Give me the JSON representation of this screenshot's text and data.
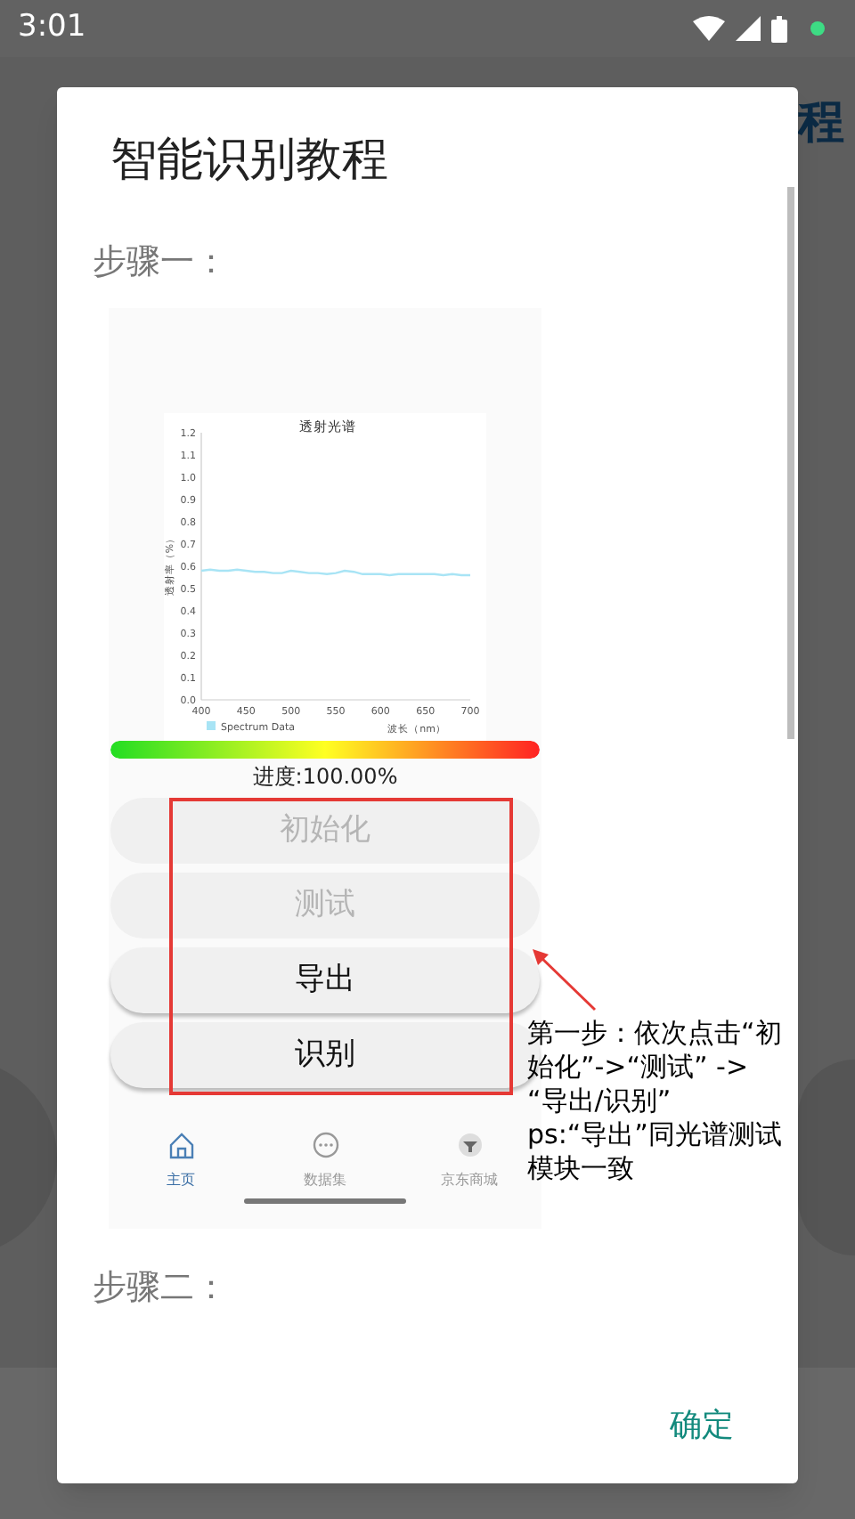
{
  "status_bar": {
    "time": "3:01"
  },
  "background": {
    "title_fragment": "程"
  },
  "dialog": {
    "title": "智能识别教程",
    "step_1": "步骤一：",
    "screenshot": {
      "chart_data": {
        "type": "line",
        "title": "透射光谱",
        "xlabel": "波长（nm）",
        "ylabel": "透射率（%）",
        "x": [
          400,
          410,
          420,
          430,
          440,
          450,
          460,
          470,
          480,
          490,
          500,
          510,
          520,
          530,
          540,
          550,
          560,
          570,
          580,
          590,
          600,
          610,
          620,
          630,
          640,
          650,
          660,
          670,
          680,
          690,
          700
        ],
        "series": [
          {
            "name": "Spectrum Data",
            "color": "#a8e4f5",
            "values": [
              0.58,
              0.585,
              0.58,
              0.58,
              0.585,
              0.58,
              0.575,
              0.575,
              0.57,
              0.57,
              0.58,
              0.575,
              0.57,
              0.57,
              0.565,
              0.57,
              0.58,
              0.575,
              0.565,
              0.565,
              0.565,
              0.56,
              0.565,
              0.565,
              0.565,
              0.565,
              0.565,
              0.56,
              0.565,
              0.56,
              0.56
            ]
          }
        ],
        "xlim": [
          400,
          700
        ],
        "ylim": [
          0,
          1.2
        ],
        "xticks": [
          400,
          450,
          500,
          550,
          600,
          650,
          700
        ],
        "yticks": [
          {
            "value": 0,
            "label": "0.0"
          },
          {
            "value": 0.1,
            "label": "0.1"
          },
          {
            "value": 0.2,
            "label": "0.2"
          },
          {
            "value": 0.3,
            "label": "0.3"
          },
          {
            "value": 0.4,
            "label": "0.4"
          },
          {
            "value": 0.5,
            "label": "0.5"
          },
          {
            "value": 0.6,
            "label": "0.6"
          },
          {
            "value": 0.7,
            "label": "0.7"
          },
          {
            "value": 0.8,
            "label": "0.8"
          },
          {
            "value": 0.9,
            "label": "0.9"
          },
          {
            "value": 1,
            "label": "1.0"
          },
          {
            "value": 1.1,
            "label": "1.1"
          },
          {
            "value": 1.2,
            "label": "1.2"
          }
        ]
      },
      "progress": {
        "level": 1,
        "label": "进度:100.00%"
      },
      "buttons": [
        {
          "label": "初始化",
          "disabled": true
        },
        {
          "label": "测试",
          "disabled": true
        },
        {
          "label": "导出",
          "disabled": false
        },
        {
          "label": "识别",
          "disabled": false
        }
      ],
      "nav": [
        {
          "label": "主页",
          "selected": true
        },
        {
          "label": "数据集",
          "selected": false
        },
        {
          "label": "京东商城",
          "selected": false
        }
      ]
    },
    "annotation": "第一步：依次点击“初始化”->“测试” -> “导出/识别”\nps:“导出”同光谱测试模块一致",
    "step_2": "步骤二：",
    "confirm": "确定"
  }
}
